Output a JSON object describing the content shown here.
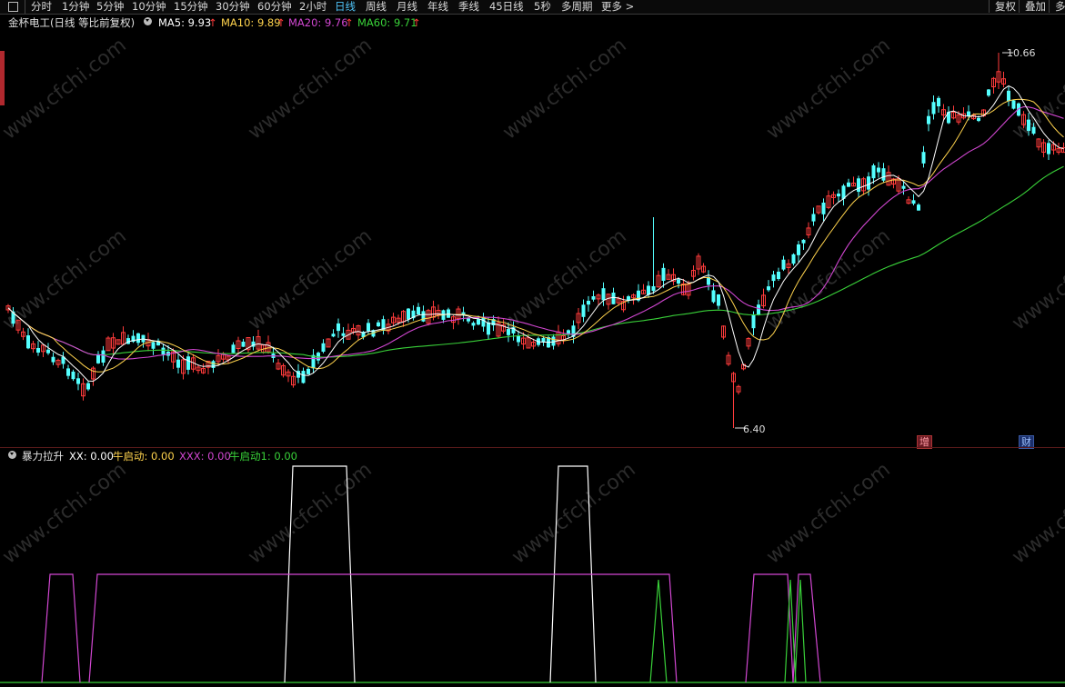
{
  "toolbar": {
    "periods": [
      "分时",
      "1分钟",
      "5分钟",
      "10分钟",
      "15分钟",
      "30分钟",
      "60分钟",
      "2小时",
      "日线",
      "周线",
      "月线",
      "年线",
      "季线",
      "45日线",
      "5秒",
      "多周期",
      "更多 >"
    ],
    "active": "日线",
    "right_buttons": [
      "复权",
      "叠加",
      "多"
    ]
  },
  "header": {
    "stock_title": "金杯电工(日线 等比前复权)",
    "ma5": "MA5: 9.93",
    "ma10": "MA10: 9.89",
    "ma20": "MA20: 9.76",
    "ma60": "MA60: 9.71",
    "up_arrow": "↑"
  },
  "sub_header": {
    "indicator": "暴力拉升",
    "xx": "XX: 0.00",
    "niu": "牛启动: 0.00",
    "xxx": "XXX: 0.00",
    "niu1": "牛启动1: 0.00"
  },
  "price_labels": {
    "high": "10.66",
    "low": "6.40"
  },
  "badges": {
    "b1": "增",
    "b2": "财"
  },
  "watermark": "www.cfchi.com",
  "colors": {
    "up": "#ff3b3b",
    "down": "#54ffff",
    "ma5": "#ffffff",
    "ma10": "#ffd34d",
    "ma20": "#d247d2",
    "ma60": "#39d139",
    "active_tab": "#4fc3f7"
  }
}
